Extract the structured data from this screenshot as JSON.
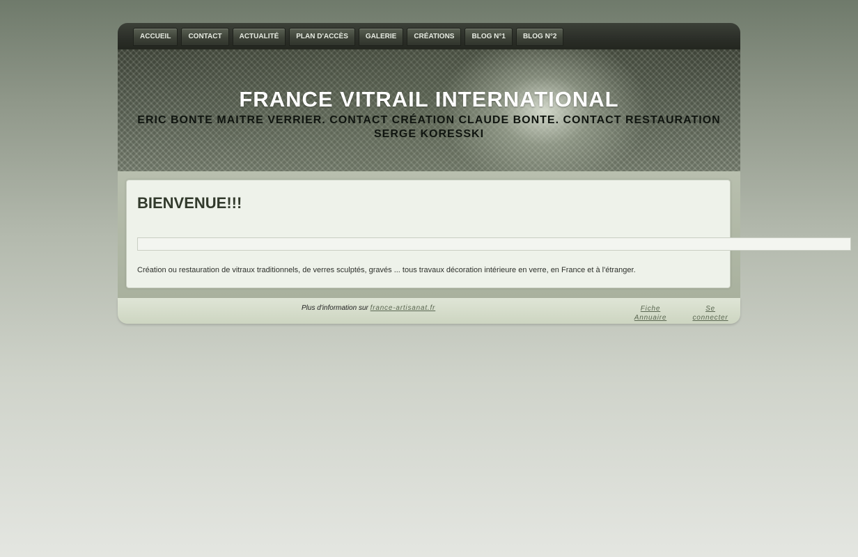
{
  "nav": {
    "items": [
      {
        "label": "ACCUEIL"
      },
      {
        "label": "CONTACT"
      },
      {
        "label": "ACTUALITÉ"
      },
      {
        "label": "PLAN D'ACCÈS"
      },
      {
        "label": "GALERIE"
      },
      {
        "label": "CRÉATIONS"
      },
      {
        "label": "BLOG N°1"
      },
      {
        "label": "BLOG N°2"
      }
    ]
  },
  "header": {
    "title": "FRANCE VITRAIL INTERNATIONAL",
    "subtitle": "ERIC BONTE MAITRE VERRIER. CONTACT CRÉATION CLAUDE BONTE. CONTACT RESTAURATION SERGE KORESSKI"
  },
  "main": {
    "heading": "BIENVENUE!!!",
    "description": "Création ou restauration de vitraux traditionnels, de verres sculptés, gravés ... tous travaux décoration intérieure en verre, en France et à l'étranger."
  },
  "footer": {
    "info_prefix": "Plus d'information sur",
    "info_link": "france-artisanat.fr",
    "annuaire_line1": "Fiche",
    "annuaire_line2": "Annuaire",
    "login_line1": "Se",
    "login_line2": "connecter"
  },
  "colors": {
    "nav_bg": "#2b2e28",
    "title_color": "#ffffff",
    "heading_color": "#323a2c",
    "link_color": "#596650"
  }
}
